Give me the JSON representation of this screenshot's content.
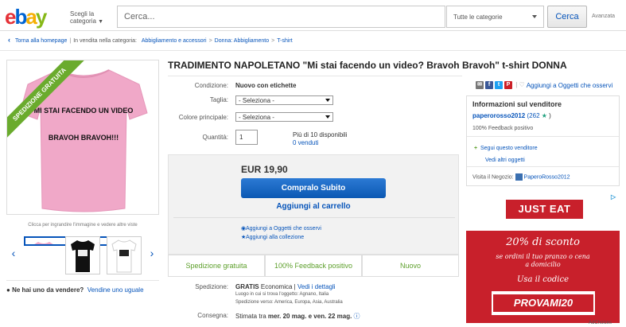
{
  "header": {
    "logo": {
      "e": "e",
      "b": "b",
      "a": "a",
      "y": "y"
    },
    "choose_category": "Scegli la categoria",
    "search_placeholder": "Cerca...",
    "category_select": "Tutte le categorie",
    "search_button": "Cerca",
    "advanced": "Avanzata"
  },
  "breadcrumb": {
    "back": "Torna alla homepage",
    "listed_in": "In vendita nella categoria:",
    "items": [
      "Abbigliamento e accessori",
      "Donna: Abbigliamento",
      "T-shirt"
    ]
  },
  "gallery": {
    "banner": "SPEDIZIONE GRATUITA",
    "shirt_text_1": "MI STAI FACENDO UN VIDEO",
    "shirt_text_2": "BRAVOH BRAVOH!!!",
    "caption": "Clicca per ingrandire l'immagine e vedere altre viste",
    "thumbnail_colors": [
      "#f0a8c8",
      "#111111",
      "#ffffff"
    ]
  },
  "sell": {
    "question": "Ne hai uno da vendere?",
    "link": "Vendine uno uguale"
  },
  "item": {
    "title": "TRADIMENTO NAPOLETANO \"Mi stai facendo un video? Bravoh Bravoh\" t-shirt DONNA",
    "condition_label": "Condizione:",
    "condition_value": "Nuovo con etichette",
    "size_label": "Taglia:",
    "size_value": "- Seleziona -",
    "color_label": "Colore principale:",
    "color_value": "- Seleziona -",
    "qty_label": "Quantità:",
    "qty_value": "1",
    "available": "Più di 10 disponibili",
    "sold": "0 venduti"
  },
  "buy": {
    "price": "EUR 19,90",
    "buy_now": "Compralo Subito",
    "add_cart": "Aggiungi al carrello",
    "add_watch": "Aggiungi a Oggetti che osservi",
    "add_collection": "Aggiungi alla collezione"
  },
  "features": [
    "Spedizione gratuita",
    "100% Feedback positivo",
    "Nuovo"
  ],
  "shipping": {
    "label": "Spedizione:",
    "free": "GRATIS",
    "method": "Economica",
    "details": "Vedi i dettagli",
    "location": "Luogo in cui si trova l'oggetto: Agnano, Italia",
    "ships_to": "Spedizione verso: America, Europa, Asia, Australia",
    "delivery_label": "Consegna:",
    "delivery_prefix": "Stimata tra",
    "delivery_dates": "mer. 20 mag. e ven. 22 mag."
  },
  "share": {
    "add_watch": "Aggiungi a Oggetti che osservi"
  },
  "seller": {
    "title": "Informazioni sul venditore",
    "name": "paperorosso2012",
    "score": "(262",
    "score_end": ")",
    "feedback": "100% Feedback positivo",
    "follow": "Segui questo venditore",
    "more": "Vedi altri oggetti",
    "store_label": "Visita il Negozio:",
    "store_name": "PaperoRosso2012"
  },
  "ad": {
    "brand": "JUST EAT",
    "discount": "20% di sconto",
    "line1": "se ordini il tuo pranzo o cena",
    "line2": "a domicilio",
    "use_code": "Usa il codice",
    "code": "PROVAMI20",
    "adchoices": "AdChoices"
  },
  "colors": {
    "link": "#0654ba",
    "buy_button": "#0b58b3",
    "feature_green": "#5ea02c",
    "ad_red": "#c8202b",
    "shirt_pink": "#f0a8c8"
  }
}
